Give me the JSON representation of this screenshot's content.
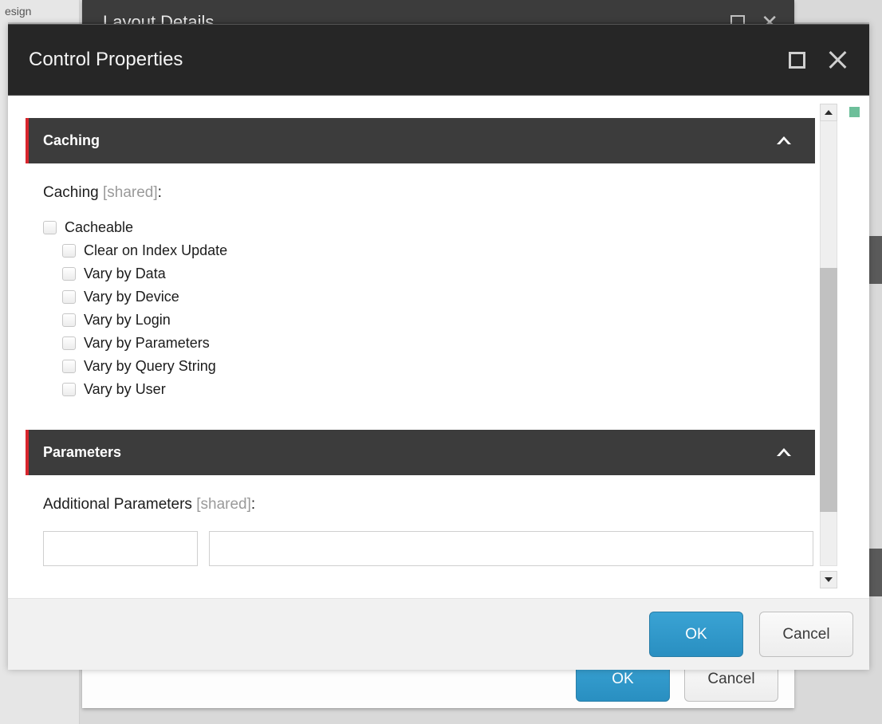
{
  "bgDialog": {
    "title": "Layout Details",
    "okLabel": "OK",
    "cancelLabel": "Cancel"
  },
  "sideFragment": "esign",
  "dialog": {
    "title": "Control Properties",
    "okLabel": "OK",
    "cancelLabel": "Cancel"
  },
  "sections": {
    "caching": {
      "title": "Caching",
      "labelPrefix": "Caching ",
      "sharedTag": "[shared]",
      "labelSuffix": ":",
      "checkboxes": [
        {
          "label": "Cacheable",
          "level": 0,
          "checked": false
        },
        {
          "label": "Clear on Index Update",
          "level": 1,
          "checked": false
        },
        {
          "label": "Vary by Data",
          "level": 1,
          "checked": false
        },
        {
          "label": "Vary by Device",
          "level": 1,
          "checked": false
        },
        {
          "label": "Vary by Login",
          "level": 1,
          "checked": false
        },
        {
          "label": "Vary by Parameters",
          "level": 1,
          "checked": false
        },
        {
          "label": "Vary by Query String",
          "level": 1,
          "checked": false
        },
        {
          "label": "Vary by User",
          "level": 1,
          "checked": false
        }
      ]
    },
    "parameters": {
      "title": "Parameters",
      "labelPrefix": "Additional Parameters ",
      "sharedTag": "[shared]",
      "labelSuffix": ":"
    }
  }
}
